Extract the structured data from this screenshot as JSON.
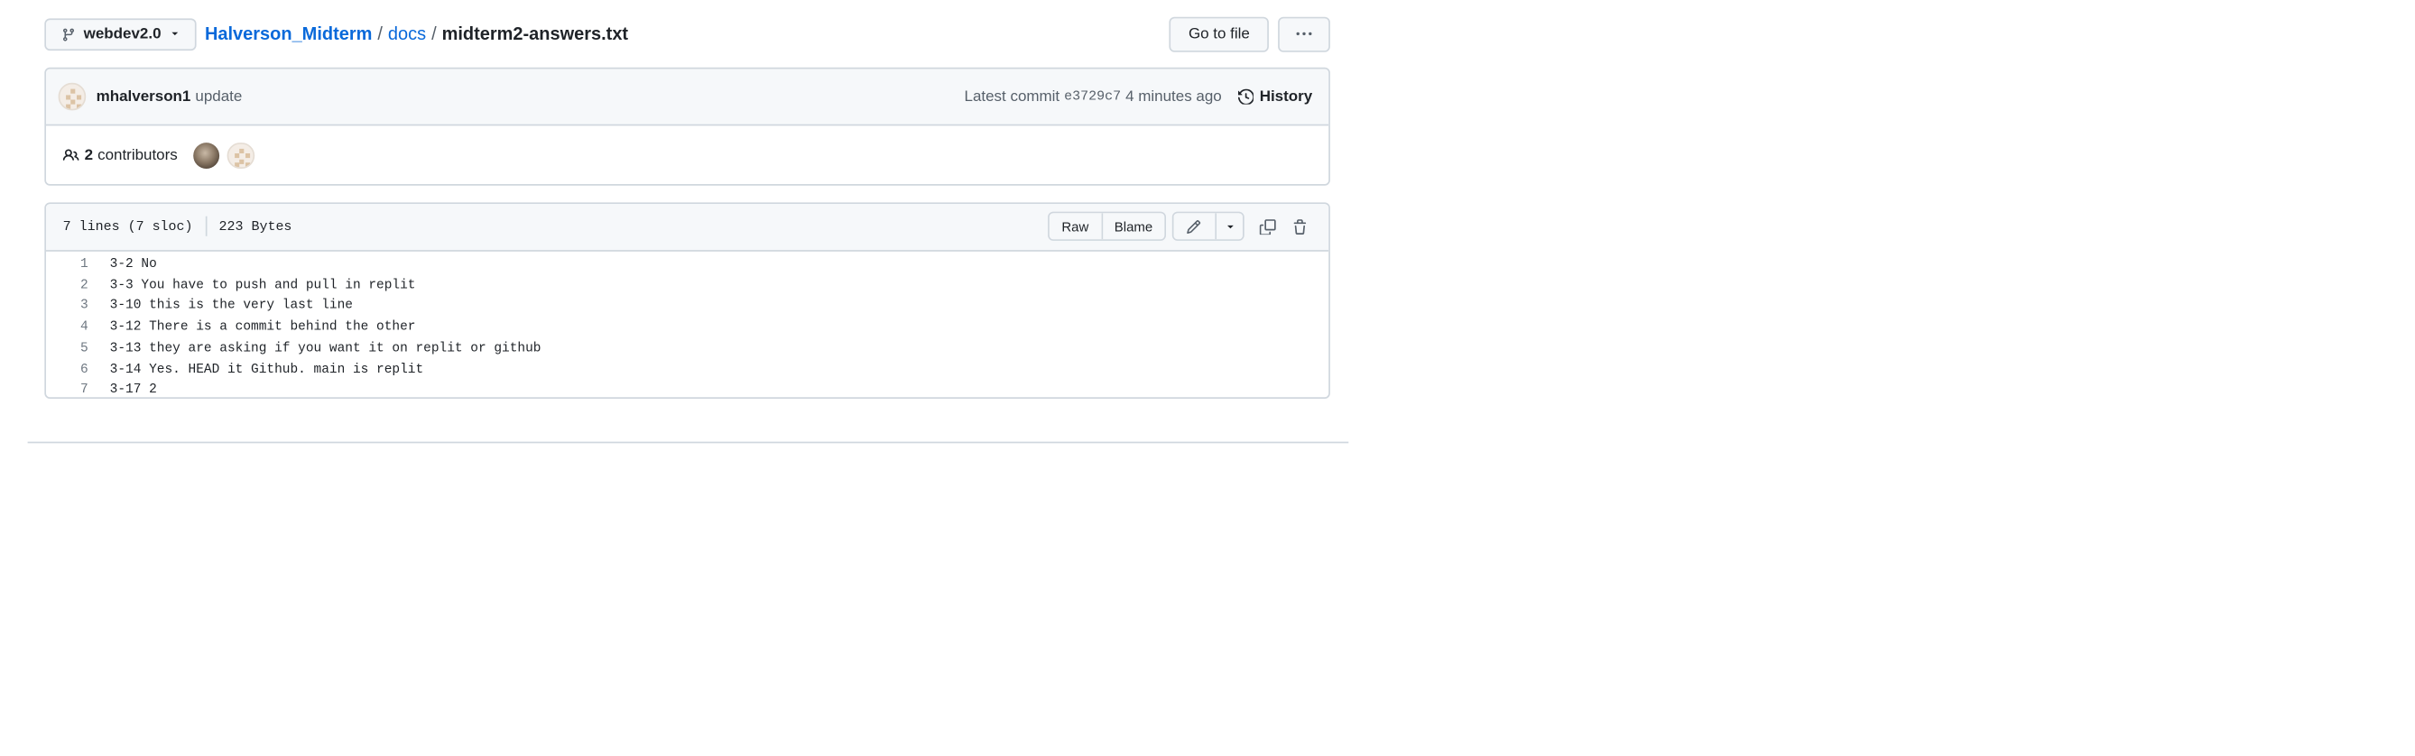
{
  "branch": {
    "name": "webdev2.0"
  },
  "breadcrumb": {
    "repo": "Halverson_Midterm",
    "folder": "docs",
    "sep": "/",
    "file": "midterm2-answers.txt"
  },
  "toolbar": {
    "go_to_file": "Go to file"
  },
  "commit": {
    "author": "mhalverson1",
    "message": "update",
    "latest_label": "Latest commit",
    "sha": "e3729c7",
    "time": "4 minutes ago",
    "history_label": "History"
  },
  "contributors": {
    "count": "2",
    "label": "contributors"
  },
  "file": {
    "lines_info": "7 lines (7 sloc)",
    "size": "223 Bytes",
    "raw_label": "Raw",
    "blame_label": "Blame"
  },
  "code_lines": [
    {
      "num": "1",
      "text": "3-2 No"
    },
    {
      "num": "2",
      "text": "3-3 You have to push and pull in replit"
    },
    {
      "num": "3",
      "text": "3-10 this is the very last line"
    },
    {
      "num": "4",
      "text": "3-12 There is a commit behind the other"
    },
    {
      "num": "5",
      "text": "3-13 they are asking if you want it on replit or github"
    },
    {
      "num": "6",
      "text": "3-14 Yes. HEAD it Github. main is replit"
    },
    {
      "num": "7",
      "text": "3-17 2"
    }
  ],
  "colors": {
    "link": "#0969da",
    "border": "#d0d7de",
    "header_bg": "#f6f8fa"
  },
  "icons": [
    "git-branch-icon",
    "caret-down-icon",
    "kebab-icon",
    "history-icon",
    "people-icon",
    "pencil-icon",
    "copy-icon",
    "trash-icon"
  ]
}
